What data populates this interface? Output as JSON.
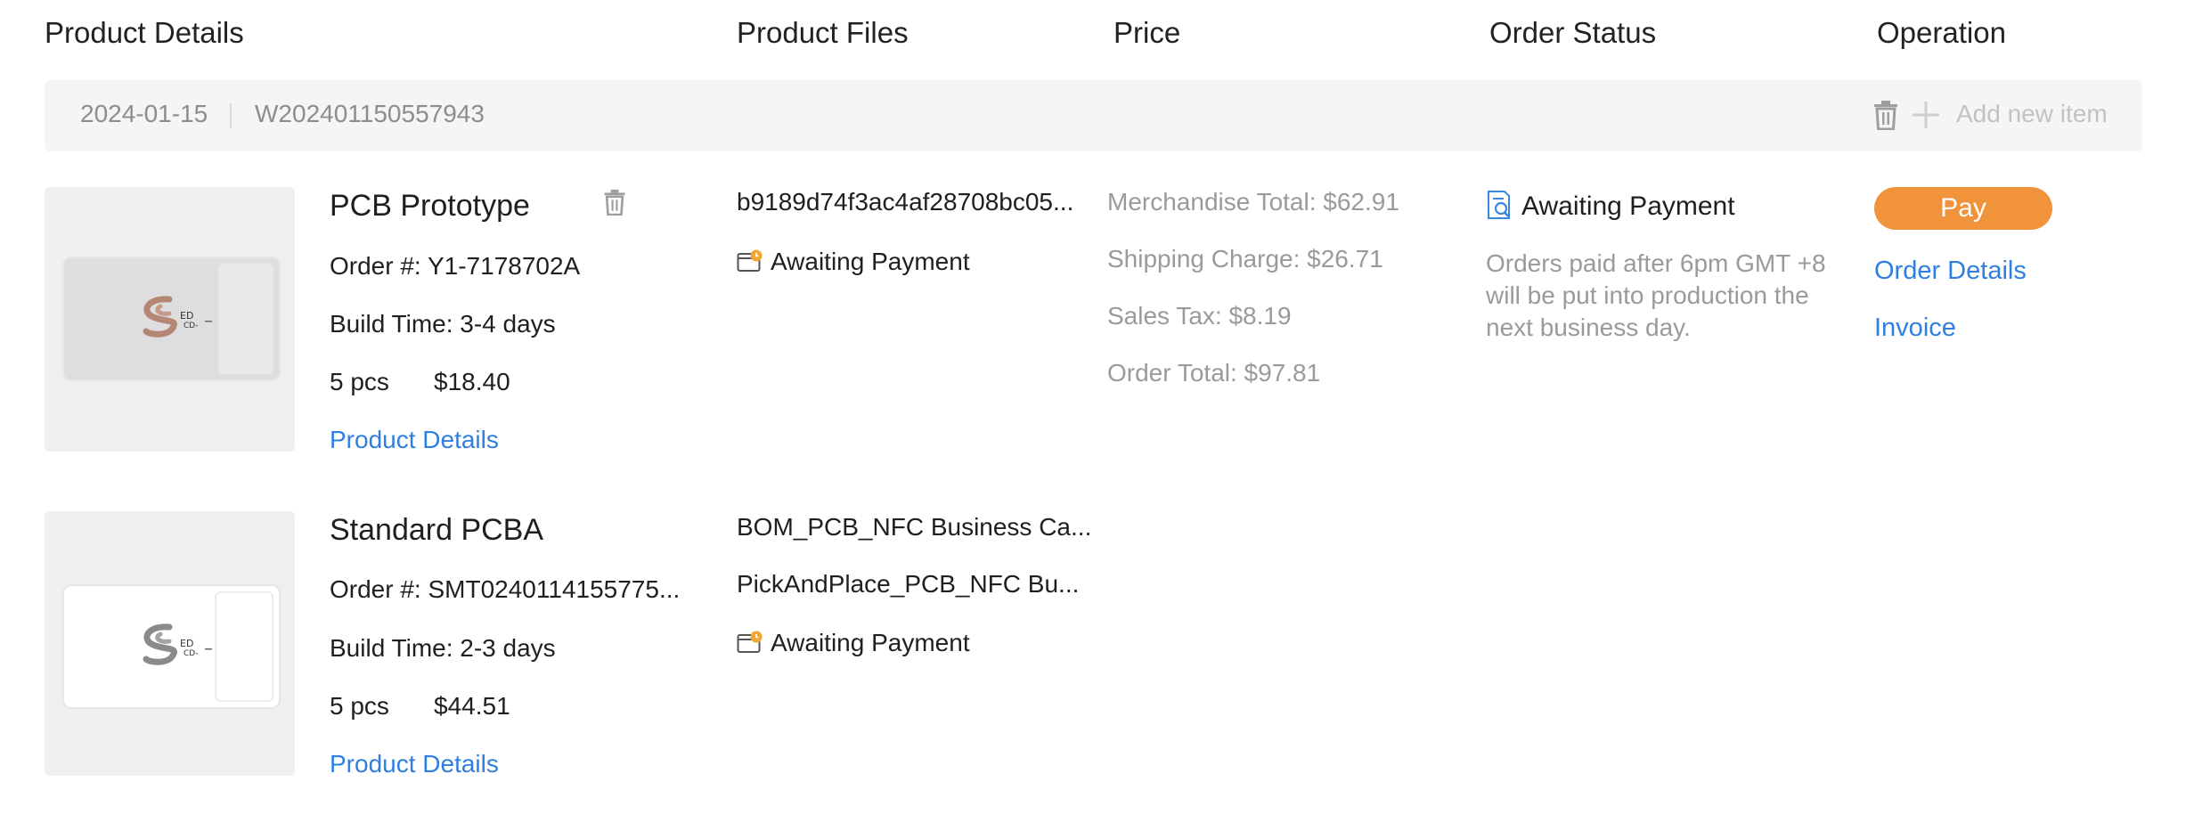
{
  "columns": {
    "product_details": "Product Details",
    "product_files": "Product Files",
    "price": "Price",
    "order_status": "Order Status",
    "operation": "Operation"
  },
  "group": {
    "date": "2024-01-15",
    "order_id": "W202401150557943",
    "add_new_item": "Add new item"
  },
  "items": [
    {
      "title": "PCB Prototype",
      "order_no": "Order #: Y1-7178702A",
      "build_time": "Build Time: 3-4 days",
      "qty": "5 pcs",
      "price": "$18.40",
      "details_link": "Product Details",
      "files": [
        "b9189d74f3ac4af28708bc05..."
      ],
      "file_status": "Awaiting Payment"
    },
    {
      "title": "Standard PCBA",
      "order_no": "Order #: SMT0240114155775...",
      "build_time": "Build Time: 2-3 days",
      "qty": "5 pcs",
      "price": "$44.51",
      "details_link": "Product Details",
      "files": [
        "BOM_PCB_NFC Business Ca...",
        "PickAndPlace_PCB_NFC Bu..."
      ],
      "file_status": "Awaiting Payment"
    }
  ],
  "pricing": {
    "merchandise_total": "Merchandise Total: $62.91",
    "shipping_charge": "Shipping Charge: $26.71",
    "sales_tax": "Sales Tax: $8.19",
    "order_total": "Order Total: $97.81"
  },
  "order_status": {
    "label": "Awaiting Payment",
    "note": "Orders paid after 6pm GMT +8 will be put into production the next business day."
  },
  "operation": {
    "pay": "Pay",
    "order_details": "Order Details",
    "invoice": "Invoice"
  },
  "colors": {
    "accent_orange": "#f0933b",
    "link_blue": "#2f7fe0",
    "muted_text": "#9a9a9a",
    "bar_bg": "#f4f5f7"
  },
  "icons": {
    "delete": "trash-icon",
    "add": "plus-icon",
    "file_status": "wallet-clock-icon",
    "order_status": "document-search-icon",
    "logo": "swirl-logo"
  }
}
